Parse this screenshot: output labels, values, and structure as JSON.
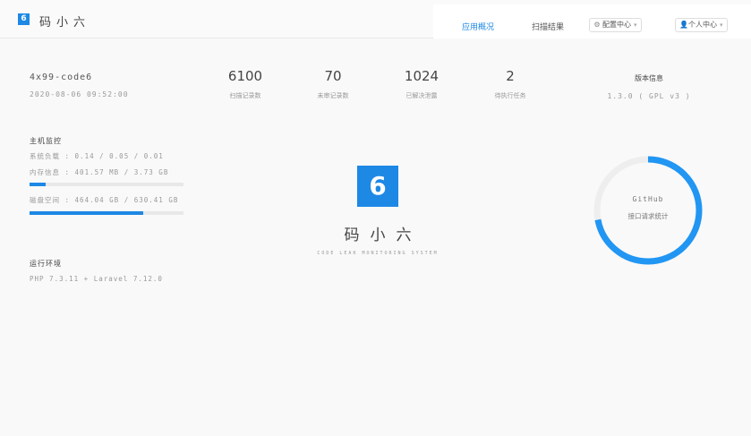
{
  "header": {
    "logo_glyph": "6",
    "brand": "码小六",
    "nav": {
      "overview": "应用概况",
      "scan_results": "扫描结果",
      "config_center": "配置中心",
      "personal_center": "个人中心"
    },
    "icons": {
      "config": "gear-icon",
      "user": "user-icon",
      "chevron": "chevron-down-icon"
    }
  },
  "host": {
    "name": "4x99-code6",
    "time": "2020-08-06 09:52:00"
  },
  "stats": [
    {
      "value": "6100",
      "label": "扫描记录数"
    },
    {
      "value": "70",
      "label": "未审记录数"
    },
    {
      "value": "1024",
      "label": "已解决泄露"
    },
    {
      "value": "2",
      "label": "待执行任务"
    }
  ],
  "version": {
    "title": "版本信息",
    "value": "1.3.0 ( GPL v3 )"
  },
  "monitor": {
    "title": "主机监控",
    "load": "系统负载 : 0.14 / 0.05 / 0.01",
    "memory": "内存信息 : 401.57 MB / 3.73 GB",
    "memory_ratio": 0.105,
    "disk": "磁盘空间 : 464.04 GB / 630.41 GB",
    "disk_ratio": 0.736
  },
  "runtime": {
    "title": "运行环境",
    "value": "PHP 7.3.11 + Laravel 7.12.0"
  },
  "center": {
    "logo_glyph": "6",
    "name": "码小六",
    "subtitle": "CODE LEAK MONITORING SYSTEM"
  },
  "github": {
    "title": "GitHub",
    "subtitle": "接口请求统计",
    "used_ratio": 0.72,
    "colors": {
      "used": "#2196f3",
      "track": "#eeeeee"
    }
  },
  "colors": {
    "accent": "#1e88e5"
  }
}
